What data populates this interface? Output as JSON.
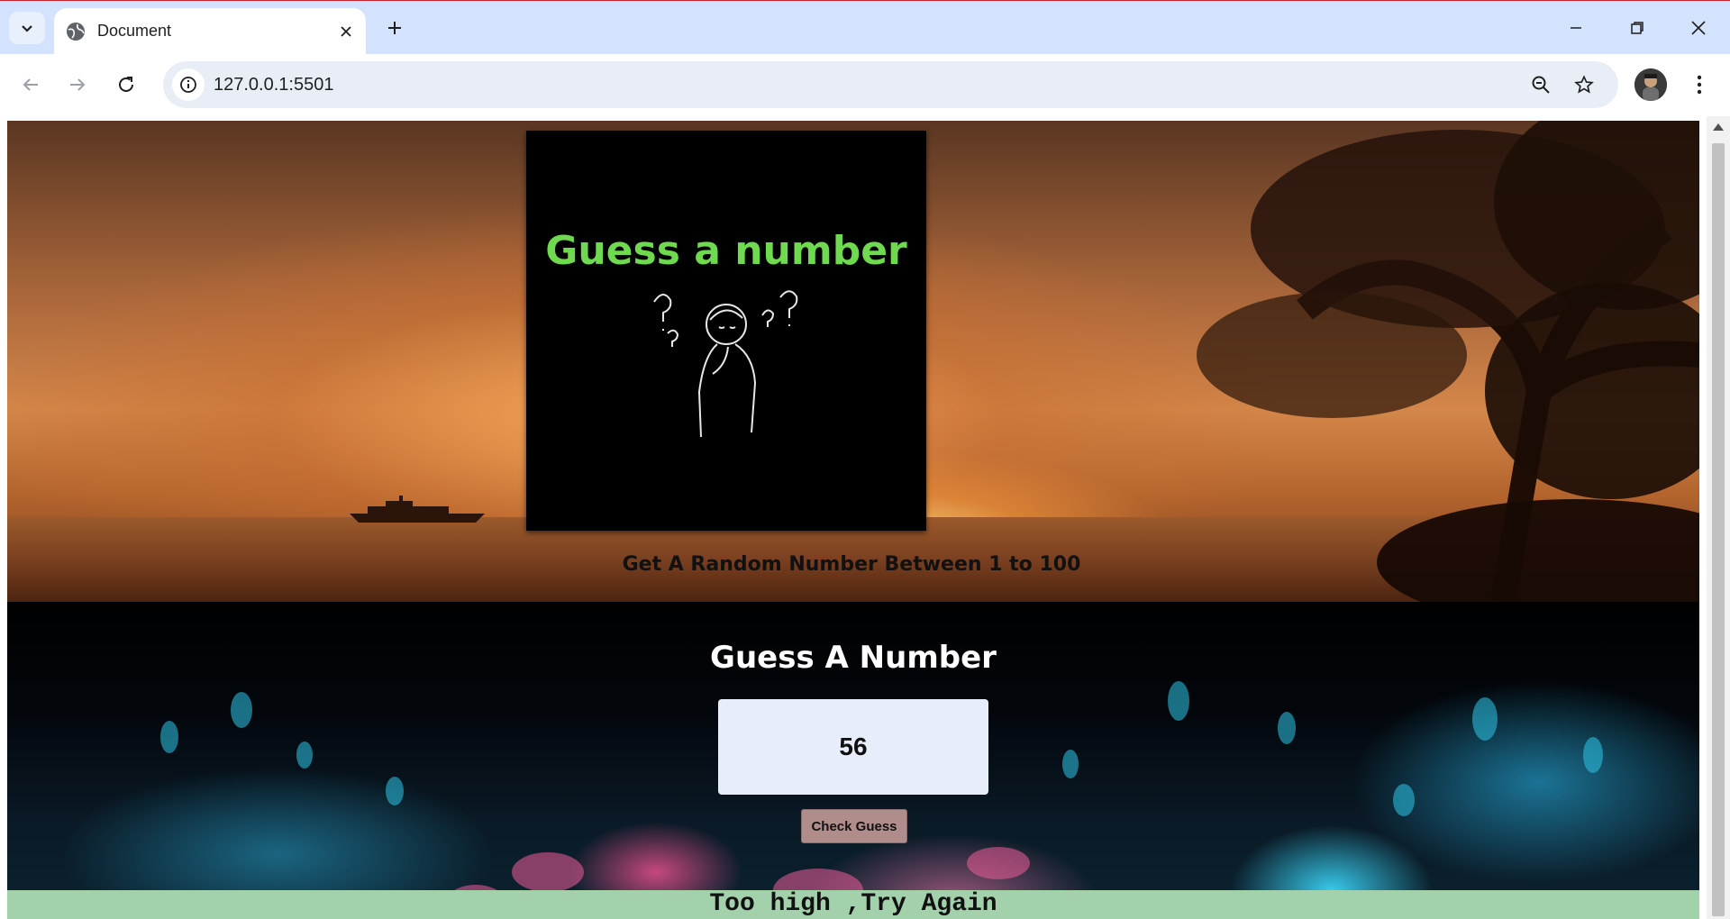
{
  "browser": {
    "tab_title": "Document",
    "url": "127.0.0.1:5501",
    "icons": [
      "tab-search-icon",
      "globe-icon",
      "close-icon",
      "plus-icon",
      "minimize-icon",
      "restore-icon",
      "window-close-icon",
      "back-icon",
      "forward-icon",
      "reload-icon",
      "info-icon",
      "zoom-icon",
      "star-icon",
      "profile-avatar",
      "kebab-menu-icon"
    ]
  },
  "hero": {
    "logo_text": "Guess a number",
    "subtitle": "Get A Random Number Between 1 to 100"
  },
  "game": {
    "heading": "Guess A Number",
    "input_value": "56",
    "button_label": "Check Guess",
    "result_message": "Too high ,Try Again"
  },
  "colors": {
    "result_bar": "#a3d1ac",
    "logo_text": "#6fd94f",
    "button": "#b08d8a",
    "input_bg": "#e8edfb"
  }
}
